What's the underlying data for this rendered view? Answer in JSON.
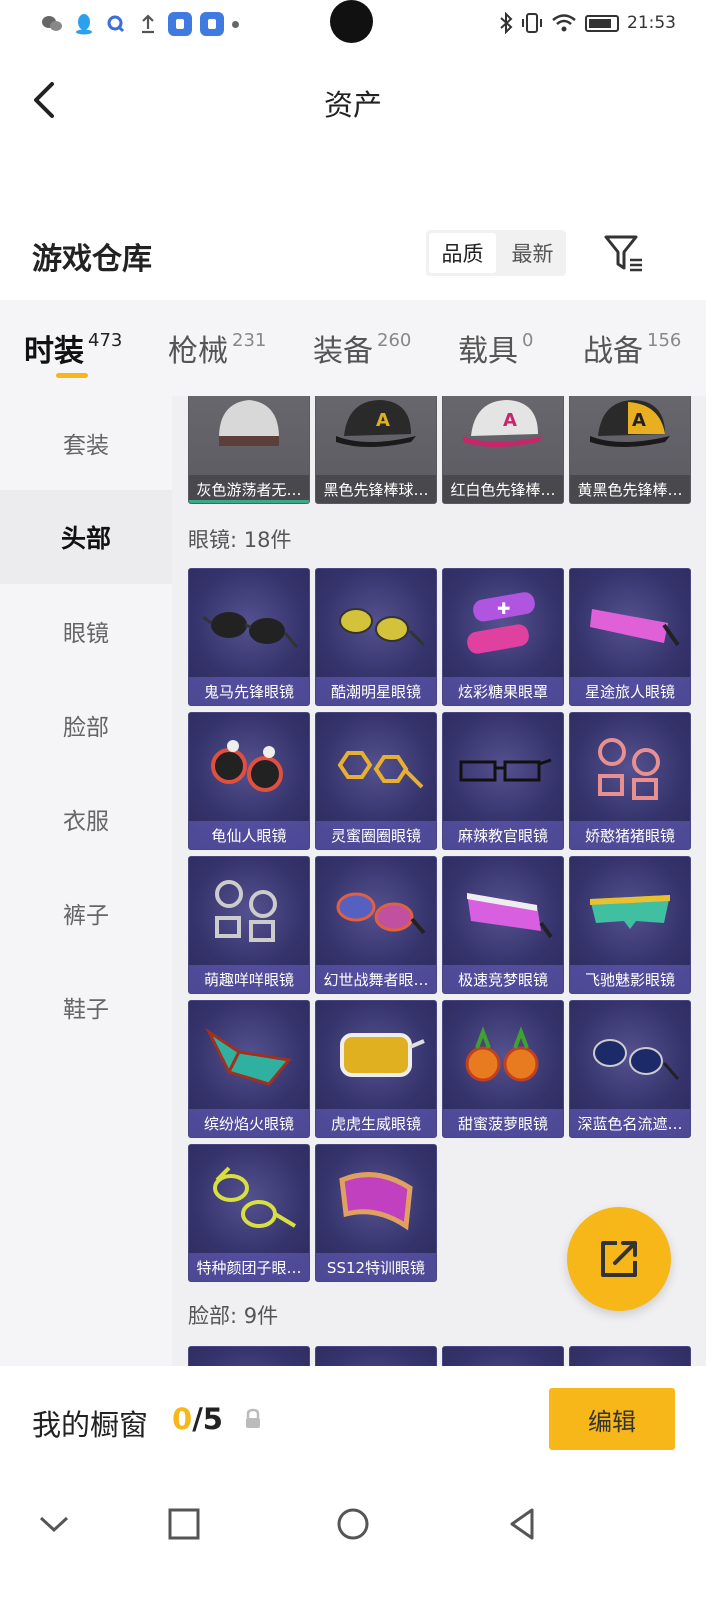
{
  "status_bar": {
    "time": "21:53",
    "left_icons": [
      "wechat-icon",
      "qq-icon",
      "search-app-icon",
      "upload-icon",
      "app-icon",
      "app-icon",
      "dot"
    ],
    "right_icons": [
      "bluetooth-icon",
      "vibrate-icon",
      "wifi-icon",
      "battery-icon"
    ]
  },
  "header": {
    "title": "资产",
    "back_icon": "chevron-left-icon"
  },
  "warehouse": {
    "title": "游戏仓库",
    "sort_options": [
      "品质",
      "最新"
    ],
    "active_sort": "品质",
    "filter_icon": "filter-icon"
  },
  "tabs": [
    {
      "label": "时装",
      "count": "473",
      "active": true
    },
    {
      "label": "枪械",
      "count": "231",
      "active": false
    },
    {
      "label": "装备",
      "count": "260",
      "active": false
    },
    {
      "label": "载具",
      "count": "0",
      "active": false
    },
    {
      "label": "战备",
      "count": "156",
      "active": false
    }
  ],
  "sidebar": {
    "items": [
      {
        "label": "套装",
        "active": false
      },
      {
        "label": "头部",
        "active": true
      },
      {
        "label": "眼镜",
        "active": false
      },
      {
        "label": "脸部",
        "active": false
      },
      {
        "label": "衣服",
        "active": false
      },
      {
        "label": "裤子",
        "active": false
      },
      {
        "label": "鞋子",
        "active": false
      }
    ]
  },
  "content": {
    "head_items": [
      {
        "name": "灰色游荡者无…"
      },
      {
        "name": "黑色先锋棒球…"
      },
      {
        "name": "红白色先锋棒…"
      },
      {
        "name": "黄黑色先锋棒…"
      }
    ],
    "glasses_section": {
      "title": "眼镜: 18件"
    },
    "glasses_items": [
      {
        "name": "鬼马先锋眼镜"
      },
      {
        "name": "酷潮明星眼镜"
      },
      {
        "name": "炫彩糖果眼罩"
      },
      {
        "name": "星途旅人眼镜"
      },
      {
        "name": "龟仙人眼镜"
      },
      {
        "name": "灵蜜圈圈眼镜"
      },
      {
        "name": "麻辣教官眼镜"
      },
      {
        "name": "娇憨猪猪眼镜"
      },
      {
        "name": "萌趣咩咩眼镜"
      },
      {
        "name": "幻世战舞者眼…"
      },
      {
        "name": "极速竞梦眼镜"
      },
      {
        "name": "飞驰魅影眼镜"
      },
      {
        "name": "缤纷焰火眼镜"
      },
      {
        "name": "虎虎生威眼镜"
      },
      {
        "name": "甜蜜菠萝眼镜"
      },
      {
        "name": "深蓝色名流遮…"
      },
      {
        "name": "特种颜团子眼…"
      },
      {
        "name": "SS12特训眼镜"
      }
    ],
    "face_section": {
      "title": "脸部: 9件"
    }
  },
  "fab": {
    "icon": "share-icon"
  },
  "showcase": {
    "title": "我的橱窗",
    "current": "0",
    "total": "/5",
    "lock_icon": "lock-icon",
    "edit_label": "编辑"
  },
  "navbar": {
    "buttons": [
      "chevron-down-icon",
      "square-icon",
      "circle-icon",
      "triangle-back-icon"
    ]
  },
  "colors": {
    "accent": "#f7b719",
    "card_bg": "#35336b",
    "card_label": "#7a6edc"
  }
}
